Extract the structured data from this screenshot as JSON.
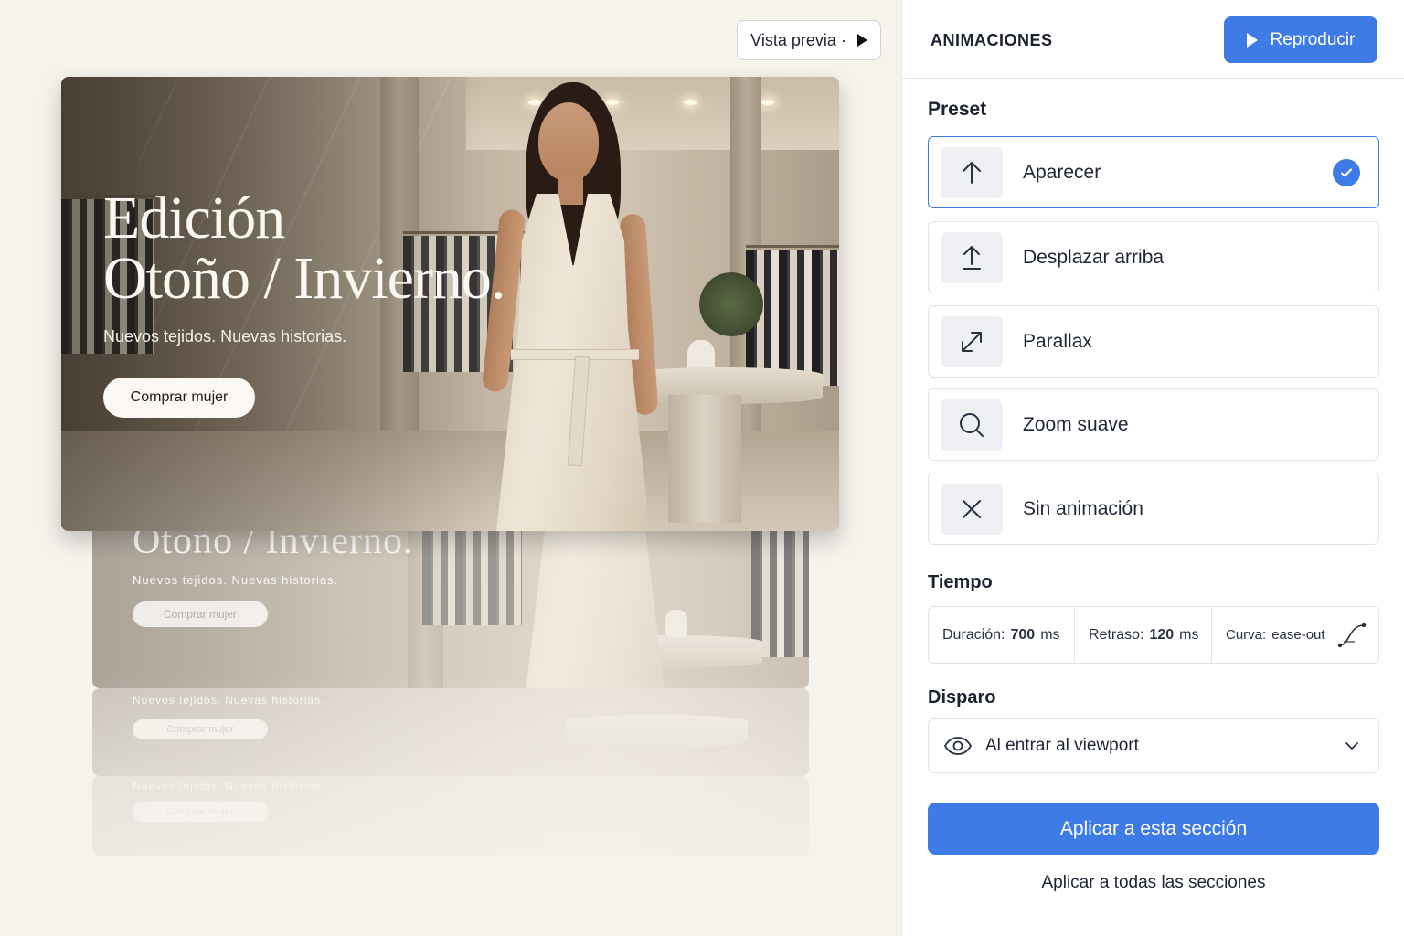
{
  "canvas": {
    "preview_button": "Vista previa ·",
    "hero": {
      "title_line1": "Edición",
      "title_line2": "Otoño / Invierno.",
      "subtitle": "Nuevos tejidos. Nuevas historias.",
      "cta": "Comprar mujer"
    }
  },
  "panel": {
    "title": "ANIMACIONES",
    "play_button": "Reproducir",
    "preset_label": "Preset",
    "presets": [
      {
        "label": "Aparecer",
        "icon": "arrow-up-icon",
        "selected": true
      },
      {
        "label": "Desplazar arriba",
        "icon": "upload-icon",
        "selected": false
      },
      {
        "label": "Parallax",
        "icon": "expand-diagonal-icon",
        "selected": false
      },
      {
        "label": "Zoom suave",
        "icon": "search-icon",
        "selected": false
      },
      {
        "label": "Sin animación",
        "icon": "close-icon",
        "selected": false
      }
    ],
    "timing_label": "Tiempo",
    "timing": {
      "duration_key": "Duración:",
      "duration_value": "700",
      "duration_unit": "ms",
      "delay_key": "Retraso:",
      "delay_value": "120",
      "delay_unit": "ms",
      "curve_key": "Curva:",
      "curve_value": "ease-out"
    },
    "trigger_label": "Disparo",
    "trigger_value": "Al entrar al viewport",
    "apply_button": "Aplicar a esta sección",
    "apply_all": "Aplicar a todas las secciones"
  },
  "colors": {
    "accent": "#3e7be6",
    "canvas_bg": "#f6f2ec",
    "panel_bg": "#ffffff"
  }
}
